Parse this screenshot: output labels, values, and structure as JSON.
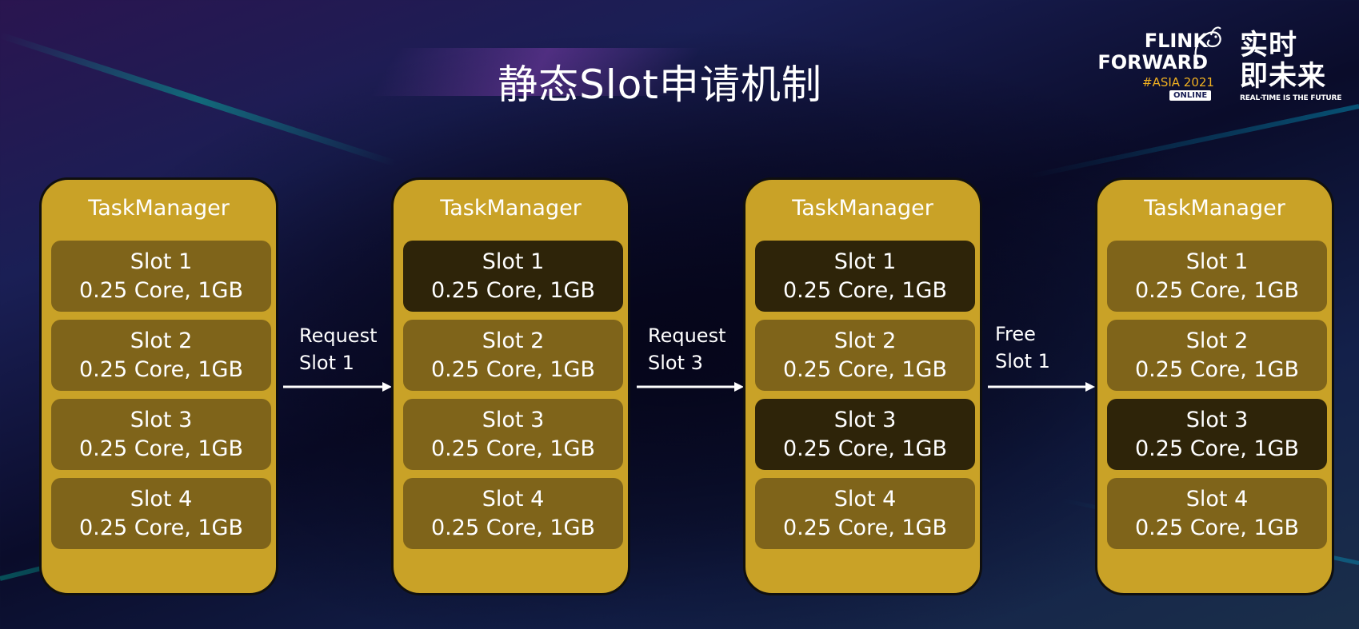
{
  "title": "静态Slot申请机制",
  "logo": {
    "flink": "FLINK",
    "forward": "FORWARD",
    "asia": "#ASIA 2021",
    "online": "ONLINE",
    "cn_line1": "实时",
    "cn_line2": "即未来",
    "en": "REAL-TIME IS THE FUTURE"
  },
  "colors": {
    "taskmanager_fill": "#c9a227",
    "slot_free": "#7f641a",
    "slot_used": "#2e2409",
    "arrow": "#ffffff"
  },
  "task_managers": [
    {
      "title": "TaskManager",
      "slots": [
        {
          "name": "Slot 1",
          "resource": "0.25 Core, 1GB",
          "state": "free"
        },
        {
          "name": "Slot 2",
          "resource": "0.25 Core, 1GB",
          "state": "free"
        },
        {
          "name": "Slot 3",
          "resource": "0.25 Core, 1GB",
          "state": "free"
        },
        {
          "name": "Slot 4",
          "resource": "0.25 Core, 1GB",
          "state": "free"
        }
      ]
    },
    {
      "title": "TaskManager",
      "slots": [
        {
          "name": "Slot 1",
          "resource": "0.25 Core, 1GB",
          "state": "used"
        },
        {
          "name": "Slot 2",
          "resource": "0.25 Core, 1GB",
          "state": "free"
        },
        {
          "name": "Slot 3",
          "resource": "0.25 Core, 1GB",
          "state": "free"
        },
        {
          "name": "Slot 4",
          "resource": "0.25 Core, 1GB",
          "state": "free"
        }
      ]
    },
    {
      "title": "TaskManager",
      "slots": [
        {
          "name": "Slot 1",
          "resource": "0.25 Core, 1GB",
          "state": "used"
        },
        {
          "name": "Slot 2",
          "resource": "0.25 Core, 1GB",
          "state": "free"
        },
        {
          "name": "Slot 3",
          "resource": "0.25 Core, 1GB",
          "state": "used"
        },
        {
          "name": "Slot 4",
          "resource": "0.25 Core, 1GB",
          "state": "free"
        }
      ]
    },
    {
      "title": "TaskManager",
      "slots": [
        {
          "name": "Slot 1",
          "resource": "0.25 Core, 1GB",
          "state": "free"
        },
        {
          "name": "Slot 2",
          "resource": "0.25 Core, 1GB",
          "state": "free"
        },
        {
          "name": "Slot 3",
          "resource": "0.25 Core, 1GB",
          "state": "used"
        },
        {
          "name": "Slot 4",
          "resource": "0.25 Core, 1GB",
          "state": "free"
        }
      ]
    }
  ],
  "transitions": [
    {
      "line1": "Request",
      "line2": "Slot 1"
    },
    {
      "line1": "Request",
      "line2": "Slot 3"
    },
    {
      "line1": "Free",
      "line2": "Slot 1"
    }
  ]
}
